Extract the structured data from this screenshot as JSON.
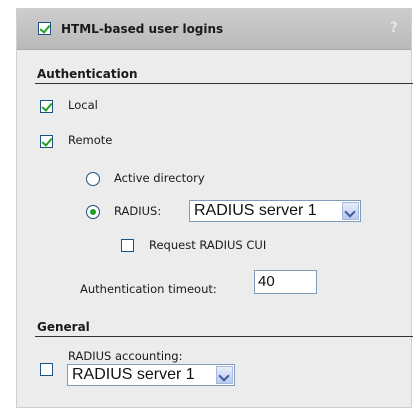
{
  "header": {
    "title": "HTML-based user logins",
    "checked": true,
    "help_glyph": "?"
  },
  "authentication": {
    "title": "Authentication",
    "local": {
      "label": "Local",
      "checked": true
    },
    "remote": {
      "label": "Remote",
      "checked": true
    },
    "active_directory": {
      "label": "Active directory",
      "selected": false
    },
    "radius": {
      "label": "RADIUS:",
      "selected": true,
      "server_value": "RADIUS server 1"
    },
    "request_cui": {
      "label": "Request RADIUS CUI",
      "checked": false
    },
    "timeout": {
      "label": "Authentication timeout:",
      "value": "40"
    }
  },
  "general": {
    "title": "General",
    "radius_accounting": {
      "label": "RADIUS accounting:",
      "checked": false,
      "server_value": "RADIUS server 1"
    }
  },
  "colors": {
    "check_green": "#21a121",
    "border_blue": "#1c5180",
    "panel_bg": "#ececec",
    "header_bg": "#c3c3c3"
  }
}
